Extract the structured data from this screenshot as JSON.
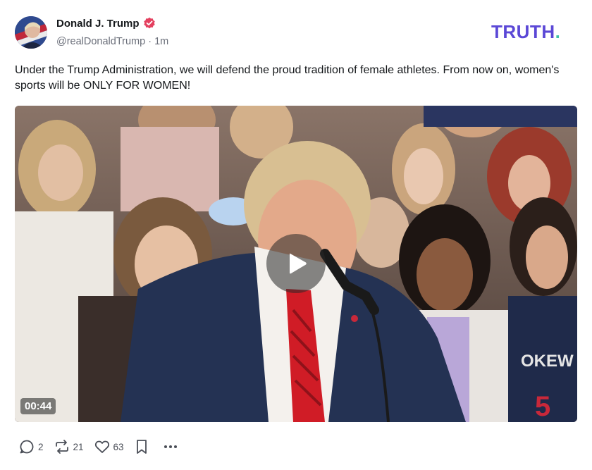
{
  "author": {
    "name": "Donald J. Trump",
    "handle": "@realDonaldTrump",
    "separator": " · ",
    "time": "1m"
  },
  "brand": {
    "logo_text": "TRUTH",
    "logo_dot": "."
  },
  "post": {
    "text": "Under the Trump Administration, we will defend the proud tradition of female athletes. From now on, women's sports will be ONLY FOR WOMEN!"
  },
  "video": {
    "duration": "00:44",
    "jersey_text": "OKEW",
    "jersey_number": "5"
  },
  "actions": {
    "replies": "2",
    "retruths": "21",
    "likes": "63"
  },
  "colors": {
    "brand": "#5b48d6",
    "brand_dot": "#3ec2a8",
    "verified": "#e4405f",
    "text": "#14171a",
    "muted": "#6b6f7a"
  },
  "icons": [
    "verified-badge-icon",
    "play-icon",
    "reply-icon",
    "retruth-icon",
    "like-icon",
    "bookmark-icon",
    "more-icon"
  ]
}
